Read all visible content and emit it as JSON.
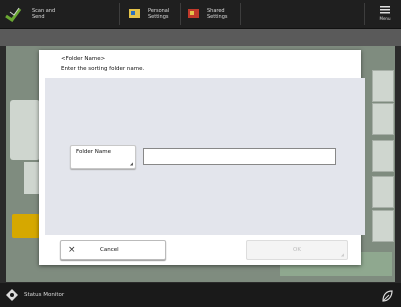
{
  "top_bar": {
    "scan_send_label": "Scan and\nSend",
    "personal_settings_label": "Personal\nSettings",
    "shared_settings_label": "Shared\nSettings",
    "menu_label": "Menu"
  },
  "dialog": {
    "title": "<Folder Name>",
    "subtitle": "Enter the sorting folder name.",
    "folder_name_button": "Folder Name",
    "folder_name_value": "",
    "cancel_label": "Cancel",
    "ok_label": "OK"
  },
  "bottom_bar": {
    "status_monitor_label": "Status Monitor"
  },
  "colors": {
    "accent_green": "#6aa832",
    "warning_yellow": "#d6a800",
    "dialog_inner_bg": "#e3e5ec"
  }
}
